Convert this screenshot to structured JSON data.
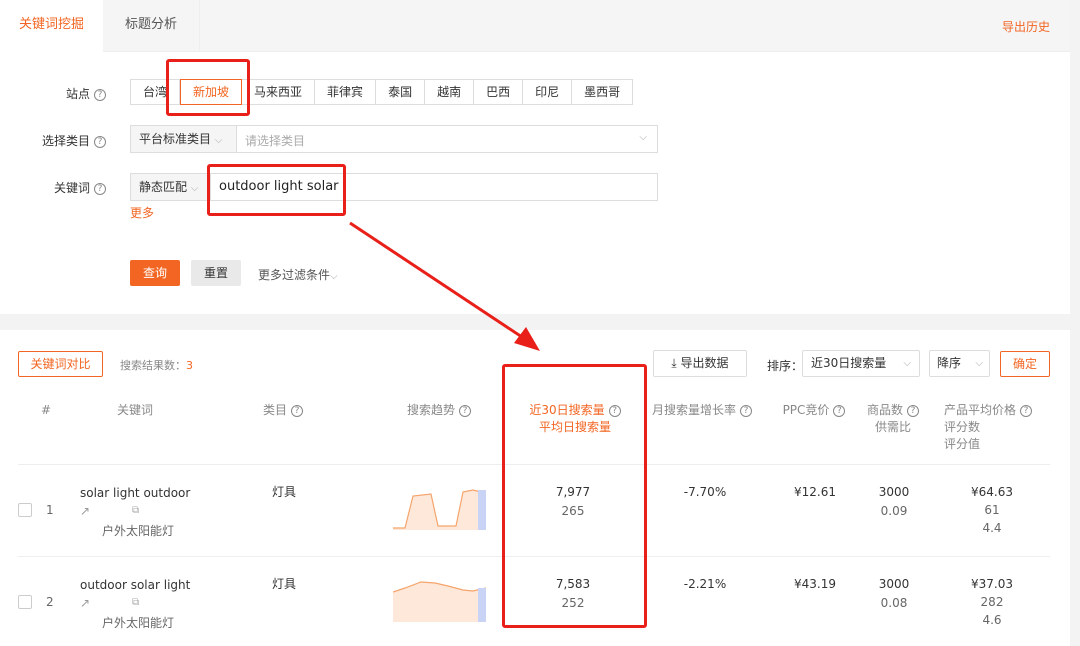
{
  "tabs": [
    {
      "label": "关键词挖掘",
      "active": true
    },
    {
      "label": "标题分析",
      "active": false
    }
  ],
  "export_history": "导出历史",
  "filters": {
    "site_label": "站点",
    "sites": [
      "台湾",
      "新加坡",
      "马来西亚",
      "菲律宾",
      "泰国",
      "越南",
      "巴西",
      "印尼",
      "墨西哥"
    ],
    "selected_site": "新加坡",
    "category_label": "选择类目",
    "category_type": "平台标准类目",
    "category_placeholder": "请选择类目",
    "keyword_label": "关键词",
    "match_type": "静态匹配",
    "keyword_value": "outdoor light solar",
    "more": "更多",
    "query_btn": "查询",
    "reset_btn": "重置",
    "more_filters": "更多过滤条件"
  },
  "results": {
    "compare_btn": "关键词对比",
    "count_label": "搜索结果数：",
    "count": "3",
    "export_btn": "导出数据",
    "sort_label": "排序：",
    "sort_value": "近30日搜索量",
    "order_value": "降序",
    "confirm_btn": "确定",
    "columns": {
      "index": "#",
      "keyword": "关键词",
      "category": "类目",
      "trend": "搜索趋势",
      "search30": "近30日搜索量",
      "daily": "平均日搜索量",
      "growth": "月搜索量增长率",
      "ppc": "PPC竞价",
      "products": "商品数",
      "supply": "供需比",
      "price": "产品平均价格",
      "rating_count": "评分数",
      "rating": "评分值"
    },
    "rows": [
      {
        "index": "1",
        "keyword": "solar light outdoor",
        "keyword_cn": "户外太阳能灯",
        "category": "灯具",
        "search30": "7,977",
        "daily": "265",
        "growth": "-7.70%",
        "ppc": "¥12.61",
        "products": "3000",
        "supply": "0.09",
        "price": "¥64.63",
        "rating_count": "61",
        "rating": "4.4"
      },
      {
        "index": "2",
        "keyword": "outdoor solar light",
        "keyword_cn": "户外太阳能灯",
        "category": "灯具",
        "search30": "7,583",
        "daily": "252",
        "growth": "-2.21%",
        "ppc": "¥43.19",
        "products": "3000",
        "supply": "0.08",
        "price": "¥37.03",
        "rating_count": "282",
        "rating": "4.6"
      }
    ]
  },
  "colors": {
    "accent": "#f26522",
    "annotation": "#e9201a"
  }
}
